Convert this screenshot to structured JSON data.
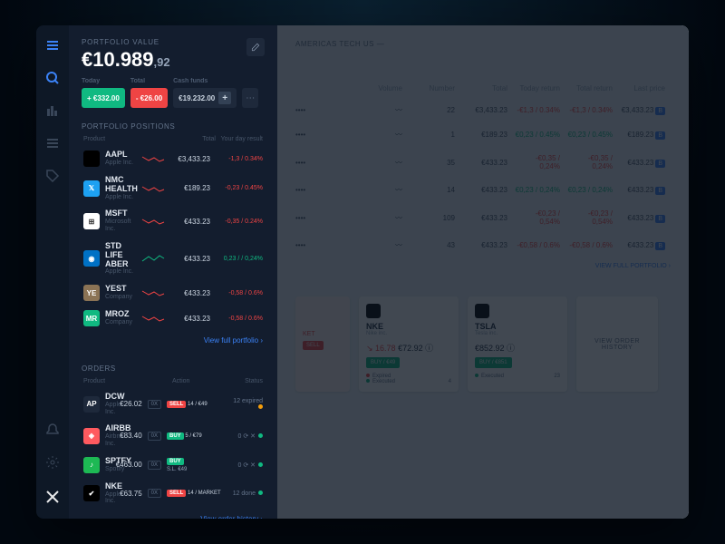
{
  "portfolio": {
    "label": "PORTFOLIO VALUE",
    "value_int": "€10.989",
    "value_dec": ",92",
    "today_label": "Today",
    "today_value": "+ €332.00",
    "total_label": "Total",
    "total_value": "- €26.00",
    "cash_label": "Cash funds",
    "cash_value": "€19.232.00"
  },
  "positions": {
    "title": "PORTFOLIO POSITIONS",
    "col_product": "Product",
    "col_total": "Total",
    "col_result": "Your day result",
    "link": "View full portfolio ›",
    "rows": [
      {
        "sym": "AAPL",
        "sub": "Apple Inc.",
        "ico": "#000",
        "glyph": "",
        "tot": "€3,433.23",
        "res": "-1,3 / 0.34%",
        "dir": "dn"
      },
      {
        "sym": "NMC HEALTH",
        "sub": "Apple Inc.",
        "ico": "#1DA1F2",
        "glyph": "𝕏",
        "tot": "€189.23",
        "res": "-0,23 / 0.45%",
        "dir": "dn"
      },
      {
        "sym": "MSFT",
        "sub": "Microsoft Inc.",
        "ico": "#fff",
        "glyph": "⊞",
        "tot": "€433.23",
        "res": "-0,35 / 0.24%",
        "dir": "dn"
      },
      {
        "sym": "STD LIFE ABER",
        "sub": "Apple Inc.",
        "ico": "#0071c5",
        "glyph": "◉",
        "tot": "€433.23",
        "res": "0,23 / / 0,24%",
        "dir": "up"
      },
      {
        "sym": "YEST",
        "sub": "Company",
        "ico": "#8b7355",
        "glyph": "YE",
        "tot": "€433.23",
        "res": "-0,58 / 0.6%",
        "dir": "dn"
      },
      {
        "sym": "MROZ",
        "sub": "Company",
        "ico": "#10b981",
        "glyph": "MR",
        "tot": "€433.23",
        "res": "-0,58 / 0.6%",
        "dir": "dn"
      }
    ]
  },
  "orders": {
    "title": "ORDERS",
    "col_product": "Product",
    "col_action": "Action",
    "col_status": "Status",
    "link": "View order history ›",
    "rows": [
      {
        "sym": "DCW",
        "sub": "Apple Inc.",
        "ico": "#1e293b",
        "glyph": "AP",
        "price": "€26.02",
        "badge": "0X",
        "act1": "SELL",
        "act1_cls": "act-sell",
        "act1_v": "14 / €49",
        "stat": "12 expired",
        "dot": "exp"
      },
      {
        "sym": "AIRBB",
        "sub": "Airbnb Inc.",
        "ico": "#FF5A5F",
        "glyph": "◈",
        "price": "€83.40",
        "badge": "0X",
        "act1": "BUY",
        "act1_cls": "act-buy",
        "act1_v": "5 / €79",
        "stat": "0 ⟳ ✕",
        "dot": "exe"
      },
      {
        "sym": "SPTFY",
        "sub": "Spotify",
        "ico": "#1DB954",
        "glyph": "♪",
        "price": "€463.00",
        "badge": "0X",
        "act1": "BUY",
        "act1_cls": "act-buy",
        "act1_v": "",
        "act2": "S.L. €49",
        "stat": "0 ⟳ ✕",
        "dot": "exe"
      },
      {
        "sym": "NKE",
        "sub": "Apple Inc.",
        "ico": "#000",
        "glyph": "✔",
        "price": "€63.75",
        "badge": "0X",
        "act1": "SELL",
        "act1_cls": "act-sell",
        "act1_v": "14 / MARKET",
        "stat": "12 done",
        "dot": "exe"
      }
    ]
  },
  "main": {
    "crumbs": "AMERICAS   TECH   US   —",
    "head": [
      "",
      "Volume",
      "Number",
      "Total",
      "Today return",
      "Total return",
      "Last price"
    ],
    "rows": [
      {
        "num": "22",
        "tot": "€3,433.23",
        "tr": "-€1,3 / 0.34%",
        "trc": "dn",
        "ttr": "-€1,3 / 0.34%",
        "ttrc": "dn",
        "lp": "€3,433.23"
      },
      {
        "num": "1",
        "tot": "€189.23",
        "tr": "€0,23 / 0.45%",
        "trc": "up",
        "ttr": "€0,23 / 0.45%",
        "ttrc": "up",
        "lp": "€189.23"
      },
      {
        "num": "35",
        "tot": "€433.23",
        "tr": "-€0,35 / 0,24%",
        "trc": "dn",
        "ttr": "-€0,35 / 0,24%",
        "ttrc": "dn",
        "lp": "€433.23"
      },
      {
        "num": "14",
        "tot": "€433.23",
        "tr": "€0,23 / 0,24%",
        "trc": "up",
        "ttr": "€0,23 / 0,24%",
        "ttrc": "up",
        "lp": "€433.23"
      },
      {
        "num": "109",
        "tot": "€433.23",
        "tr": "-€0,23 / 0,54%",
        "trc": "dn",
        "ttr": "-€0,23 / 0,54%",
        "ttrc": "dn",
        "lp": "€433.23"
      },
      {
        "num": "43",
        "tot": "€433.23",
        "tr": "-€0,58 / 0.6%",
        "trc": "dn",
        "ttr": "-€0,58 / 0.6%",
        "ttrc": "dn",
        "lp": "€433.23"
      }
    ],
    "link": "VIEW FULL PORTFOLIO ›",
    "cards": [
      {
        "ico": "#000",
        "sym": "NKE",
        "sub": "Nike inc.",
        "price": "€72.92",
        "chg": "↘ 16.78",
        "buy": "BUY / €49",
        "stat1": "Expired",
        "n1": "4",
        "stat2": "Executed",
        "n2": ""
      },
      {
        "ico": "#000",
        "sym": "TSLA",
        "sub": "Tesla inc.",
        "price": "€852.92",
        "chg": "",
        "buy": "BUY / €851",
        "stat1": "",
        "n1": "",
        "stat2": "Executed",
        "n2": "23"
      }
    ],
    "view_history": "VIEW ORDER HISTORY",
    "ket": "KET"
  }
}
